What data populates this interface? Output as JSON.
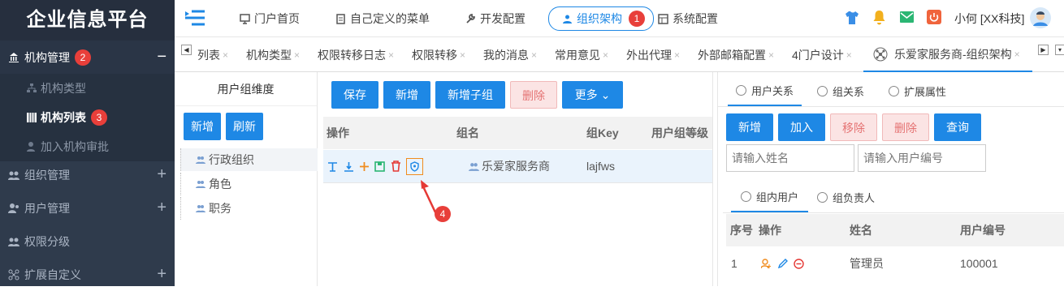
{
  "brand": {
    "title": "企业信息平台"
  },
  "sidebar": {
    "menu_1": {
      "label": "机构管理",
      "badge": "2",
      "toggle": "−"
    },
    "sub_1": {
      "label": "机构类型"
    },
    "sub_2": {
      "label": "机构列表",
      "badge": "3"
    },
    "sub_3": {
      "label": "加入机构审批"
    },
    "menu_2": {
      "label": "组织管理",
      "toggle": "+"
    },
    "menu_3": {
      "label": "用户管理",
      "toggle": "+"
    },
    "menu_4": {
      "label": "权限分级"
    },
    "menu_5": {
      "label": "扩展自定义",
      "toggle": "+"
    }
  },
  "header": {
    "nav_home": "门户首页",
    "nav_custom": "自己定义的菜单",
    "nav_dev": "开发配置",
    "nav_org": "组织架构",
    "nav_org_badge": "1",
    "nav_sys": "系统配置",
    "user": "小何 [XX科技]"
  },
  "tabs": {
    "t1": "列表",
    "t2": "机构类型",
    "t3": "权限转移日志",
    "t4": "权限转移",
    "t5": "我的消息",
    "t6": "常用意见",
    "t7": "外出代理",
    "t8": "外部邮箱配置",
    "t9": "4门户设计",
    "t10": "乐爱家服务商-组织架构",
    "close": "×"
  },
  "left_panel": {
    "title": "用户组维度",
    "add": "新增",
    "refresh": "刷新",
    "tree": {
      "a": "行政组织",
      "b": "角色",
      "c": "职务"
    }
  },
  "middle_panel": {
    "save": "保存",
    "add": "新增",
    "add_child": "新增子组",
    "delete": "删除",
    "more": "更多 ⌄",
    "headers": {
      "op": "操作",
      "name": "组名",
      "key": "组Key",
      "level": "用户组等级"
    },
    "row": {
      "name": "乐爱家服务商",
      "key": "lajfws"
    },
    "callout": "4"
  },
  "right_panel": {
    "tabs": {
      "a": "用户关系",
      "b": "组关系",
      "c": "扩展属性"
    },
    "btns": {
      "add": "新增",
      "join": "加入",
      "remove": "移除",
      "delete": "删除",
      "query": "查询"
    },
    "name_placeholder": "请输入姓名",
    "code_placeholder": "请输入用户编号",
    "subtabs": {
      "a": "组内用户",
      "b": "组负责人"
    },
    "grid_headers": {
      "seq": "序号",
      "op": "操作",
      "name": "姓名",
      "code": "用户编号"
    },
    "row": {
      "seq": "1",
      "name": "管理员",
      "code": "100001"
    }
  }
}
